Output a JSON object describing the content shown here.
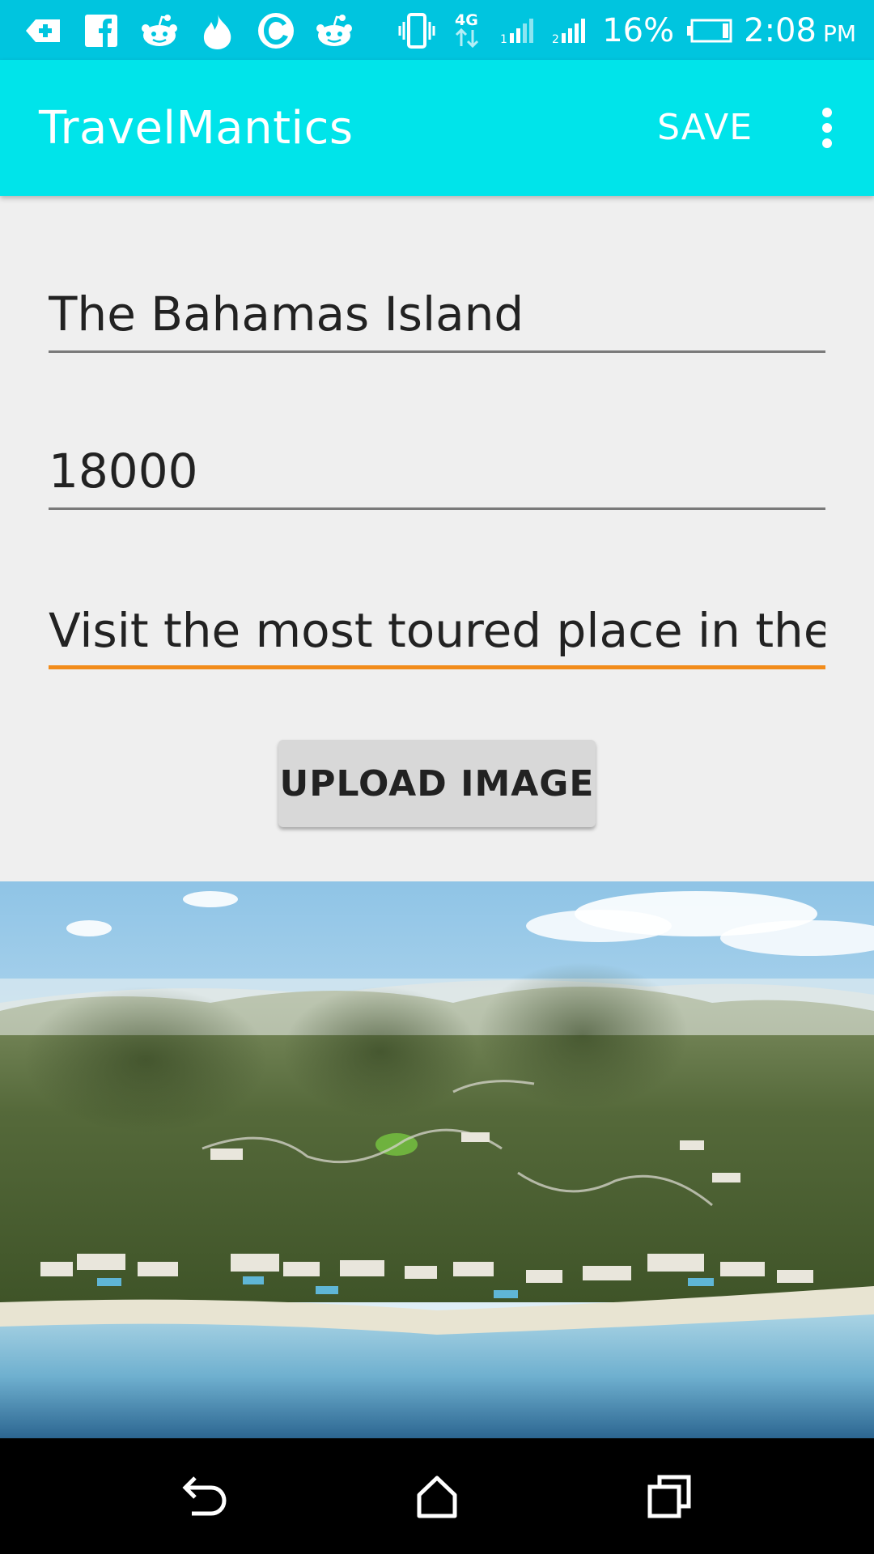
{
  "status_bar": {
    "battery_percent": "16%",
    "time": "2:08",
    "time_suffix": "PM",
    "network": "4G",
    "notification_icons": [
      "hospital-plus-icon",
      "facebook-icon",
      "reddit-icon",
      "tinder-icon",
      "opera-icon",
      "reddit-icon"
    ]
  },
  "app_bar": {
    "title": "TravelMantics",
    "save_label": "SAVE"
  },
  "form": {
    "title_value": "The Bahamas Island",
    "price_value": "18000",
    "description_value": "Visit the most toured place in the w",
    "upload_label": "UPLOAD IMAGE"
  },
  "colors": {
    "status_bar": "#00c5df",
    "app_bar": "#00e4ea",
    "focus_accent": "#f28c1b",
    "background": "#efefef"
  }
}
